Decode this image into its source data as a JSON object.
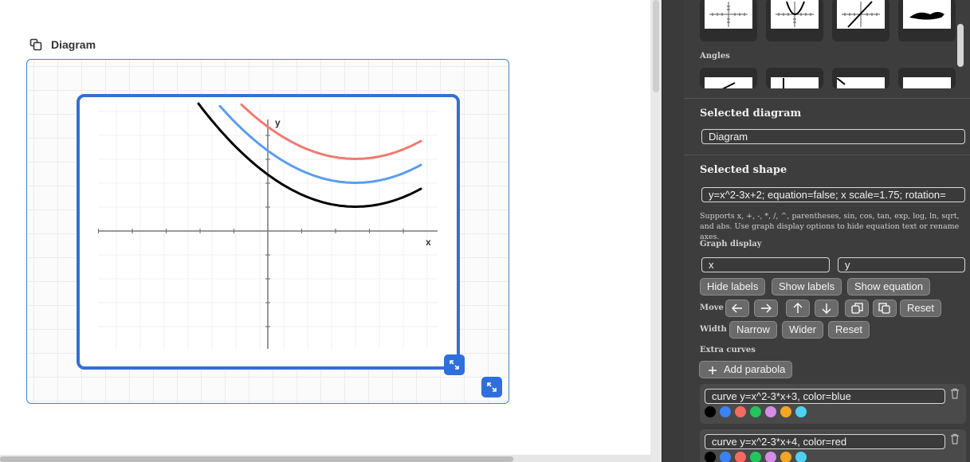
{
  "diagram": {
    "title": "Diagram"
  },
  "graph": {
    "x_label": "x",
    "y_label": "y",
    "colors": {
      "base": "#000000",
      "blue": "#5b9cf0",
      "red": "#f07a6f"
    }
  },
  "panel": {
    "angles_label": "Angles",
    "selected_diagram_title": "Selected diagram",
    "diagram_name": "Diagram",
    "selected_shape_title": "Selected shape",
    "shape_spec": "y=x^2-3x+2; equation=false; x scale=1.75; rotation=",
    "help_text": "Supports x, +, -, *, /, ^, parentheses, sin, cos, tan, exp, log, ln, sqrt, and abs. Use graph display options to hide equation text or rename axes.",
    "graph_display_label": "Graph display",
    "x_axis_name": "x",
    "y_axis_name": "y",
    "hide_labels": "Hide labels",
    "show_labels": "Show labels",
    "show_equation": "Show equation",
    "move_label": "Move",
    "move_reset": "Reset",
    "width_label": "Width",
    "narrow": "Narrow",
    "wider": "Wider",
    "width_reset": "Reset",
    "extra_curves_label": "Extra curves",
    "add_parabola": "Add parabola",
    "curves": [
      {
        "spec": "curve y=x^2-3*x+3, color=blue"
      },
      {
        "spec": "curve y=x^2-3*x+4, color=red"
      }
    ],
    "swatch_colors": [
      "#000000",
      "#3b82f6",
      "#f26b5e",
      "#22c55e",
      "#d98be8",
      "#f5a524",
      "#4fd1f0"
    ]
  }
}
